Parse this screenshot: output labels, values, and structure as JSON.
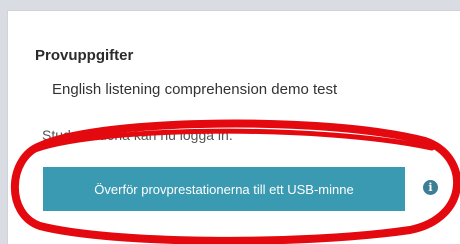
{
  "panel": {
    "heading": "Provuppgifter",
    "exam_name": "English listening comprehension demo test",
    "status_text": "Studerandena kan nu logga in.",
    "usb_button_label": "Överför provprestationerna till ett USB-minne",
    "info_icon_glyph": "i"
  },
  "colors": {
    "button": "#3a9ab1",
    "annotation": "#e4080f"
  },
  "icons": [
    "info-icon"
  ]
}
